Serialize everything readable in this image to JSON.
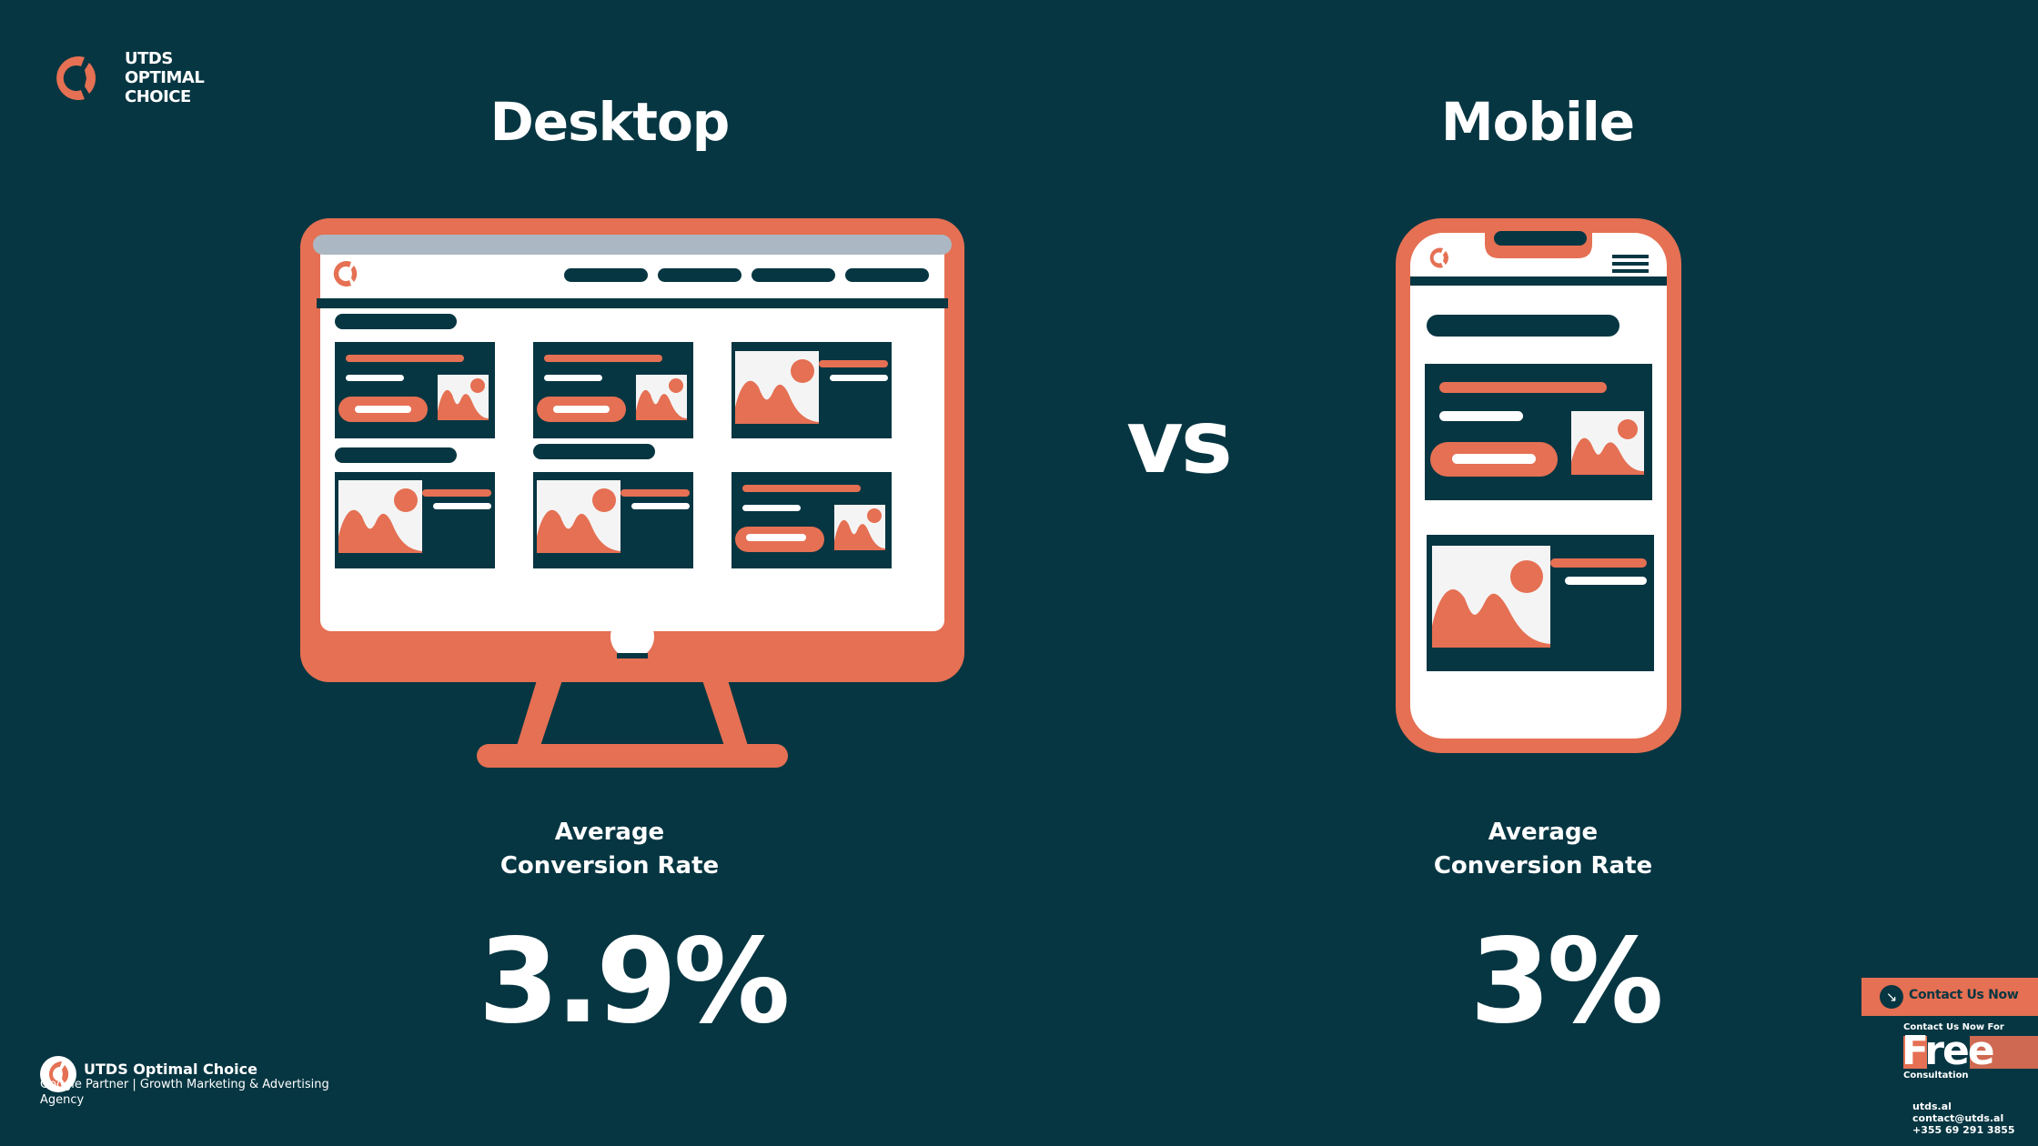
{
  "brand": {
    "logo_icon": "utds-logo-icon",
    "name_lines": [
      "UTDS",
      "OPTIMAL",
      "CHOICE"
    ]
  },
  "colors": {
    "background": "#063642",
    "accent": "#e57053",
    "screen": "#ffffff",
    "browser_bar": "#abb7c2",
    "image_bg": "#f4f4f4"
  },
  "comparison": {
    "left": {
      "title": "Desktop",
      "device_icon": "desktop-monitor-icon",
      "label_line1": "Average",
      "label_line2": "Conversion Rate",
      "value": "3.9%"
    },
    "separator": "vs",
    "right": {
      "title": "Mobile",
      "device_icon": "mobile-phone-icon",
      "label_line1": "Average",
      "label_line2": "Conversion Rate",
      "value": "3%"
    }
  },
  "footer": {
    "name": "UTDS Optimal Choice",
    "tagline": "Google Partner | Growth Marketing & Advertising Agency"
  },
  "cta": {
    "icon": "arrow-down-right-icon",
    "icon_glyph": "↘",
    "label": "Contact Us Now",
    "promo_top": "Contact Us Now For",
    "promo_big": "Free",
    "promo_bottom": "Consultation",
    "website": "utds.al",
    "email": "contact@utds.al",
    "phone": "+355 69 291 3855"
  }
}
